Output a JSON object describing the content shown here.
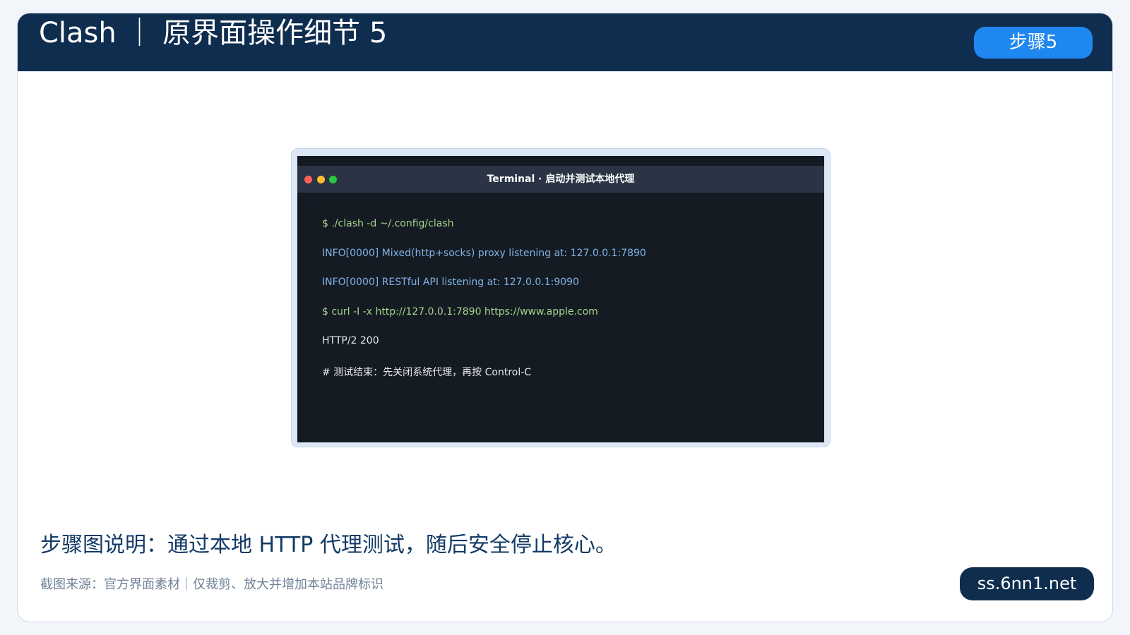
{
  "header": {
    "title": "Clash ｜ 原界面操作细节 5",
    "step_badge": "步骤5"
  },
  "terminal": {
    "title": "Terminal · 启动并测试本地代理",
    "traffic_lights": [
      "close-dot",
      "minimize-dot",
      "zoom-dot"
    ],
    "lines": [
      {
        "text": "$ ./clash -d ~/.config/clash",
        "color": "#a6d38b"
      },
      {
        "text": "INFO[0000] Mixed(http+socks) proxy listening at: 127.0.0.1:7890",
        "color": "#7fb3e6"
      },
      {
        "text": "INFO[0000] RESTful API listening at: 127.0.0.1:9090",
        "color": "#7fb3e6"
      },
      {
        "text": "$ curl -I -x http://127.0.0.1:7890 https://www.apple.com",
        "color": "#a6d38b"
      },
      {
        "text": "HTTP/2 200",
        "color": "#e6e9ee"
      },
      {
        "text": "# 测试结束：先关闭系统代理，再按 Control-C",
        "color": "#e6e9ee"
      }
    ]
  },
  "caption": "步骤图说明：通过本地 HTTP 代理测试，随后安全停止核心。",
  "source_note": "截图来源：官方界面素材｜仅裁剪、放大并增加本站品牌标识",
  "site_badge": "ss.6nn1.net",
  "colors": {
    "header_bg": "#0f2d4e",
    "accent": "#1f87f0",
    "page_bg": "#f2f6fb"
  }
}
